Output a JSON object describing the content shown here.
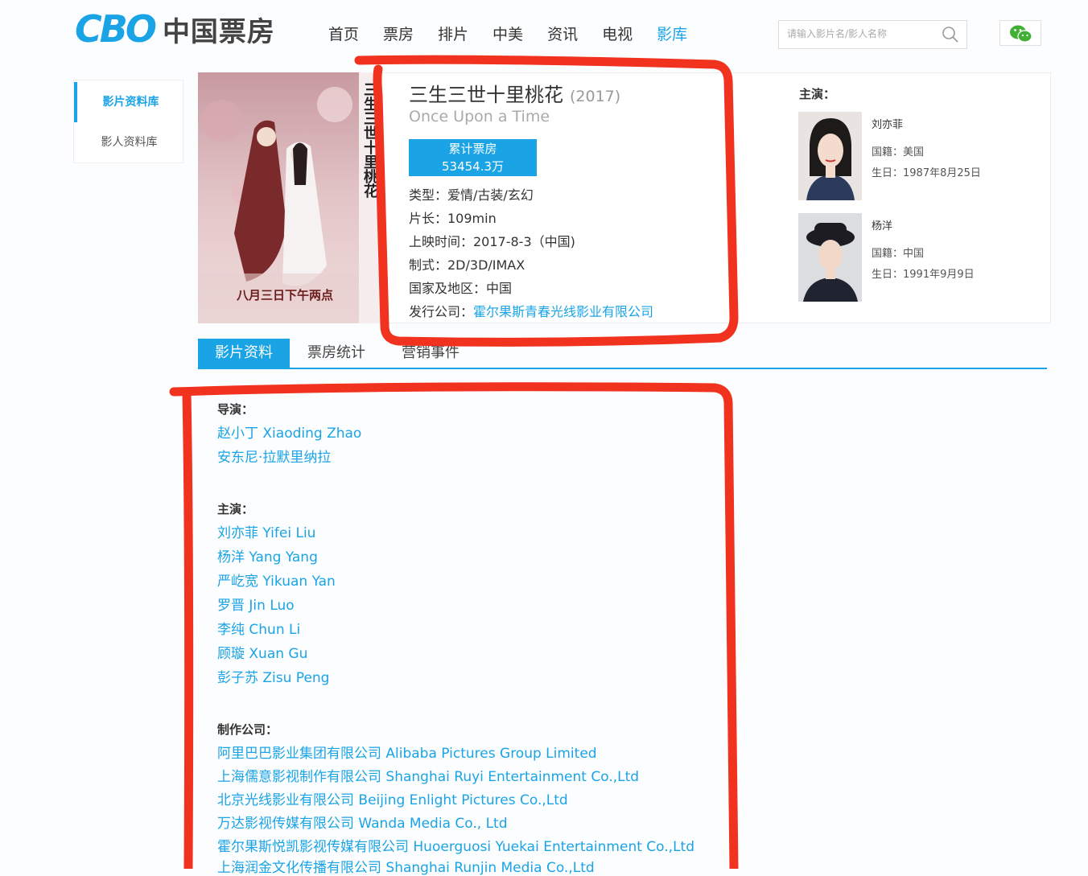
{
  "header": {
    "logo_mark": "CBO",
    "logo_text": "中国票房",
    "nav": [
      "首页",
      "票房",
      "排片",
      "中美",
      "资讯",
      "电视",
      "影库"
    ],
    "active_nav": "影库",
    "search_placeholder": "请输入影片名/影人名称"
  },
  "sidemenu": {
    "items": [
      "影片资料库",
      "影人资料库"
    ]
  },
  "movie": {
    "poster_caption": "八月三日下午两点",
    "poster_title": "三生三世十里桃花",
    "title_cn": "三生三世十里桃花",
    "year": "(2017)",
    "title_en": "Once Upon a Time",
    "box_label": "累计票房",
    "box_value": "53454.3万",
    "genre": "类型：爱情/古装/玄幻",
    "runtime": "片长：109min",
    "release": "上映时间：2017-8-3（中国)",
    "format": "制式：2D/3D/IMAX",
    "region": "国家及地区：中国",
    "distributor_label": "发行公司：",
    "distributor": "霍尔果斯青春光线影业有限公司"
  },
  "cast": {
    "heading": "主演：",
    "actors": [
      {
        "name": "刘亦菲",
        "nationality": "国籍：美国",
        "birthday": "生日：1987年8月25日"
      },
      {
        "name": "杨洋",
        "nationality": "国籍：中国",
        "birthday": "生日：1991年9月9日"
      }
    ]
  },
  "tabs": [
    "影片资料",
    "票房统计",
    "营销事件"
  ],
  "details": {
    "directors_title": "导演：",
    "directors": [
      "赵小丁 Xiaoding Zhao",
      "安东尼·拉默里纳拉"
    ],
    "stars_title": "主演：",
    "stars": [
      "刘亦菲 Yifei Liu",
      "杨洋 Yang Yang",
      "严屹宽 Yikuan Yan",
      "罗晋 Jin Luo",
      "李纯 Chun Li",
      "顾璇 Xuan Gu",
      "彭子苏 Zisu Peng"
    ],
    "producers_title": "制作公司：",
    "producers": [
      "阿里巴巴影业集团有限公司 Alibaba Pictures Group Limited",
      "上海儒意影视制作有限公司 Shanghai Ruyi Entertainment Co.,Ltd",
      "北京光线影业有限公司 Beijing Enlight Pictures Co.,Ltd",
      "万达影视传媒有限公司 Wanda Media Co., Ltd",
      "霍尔果斯悦凯影视传媒有限公司 Huoerguosi Yuekai Entertainment Co.,Ltd",
      "上海润金文化传播有限公司 Shanghai Runjin Media Co.,Ltd"
    ]
  },
  "colors": {
    "accent": "#1aa4e6",
    "annotation": "#f0321e",
    "wechat_green": "#41b035"
  }
}
